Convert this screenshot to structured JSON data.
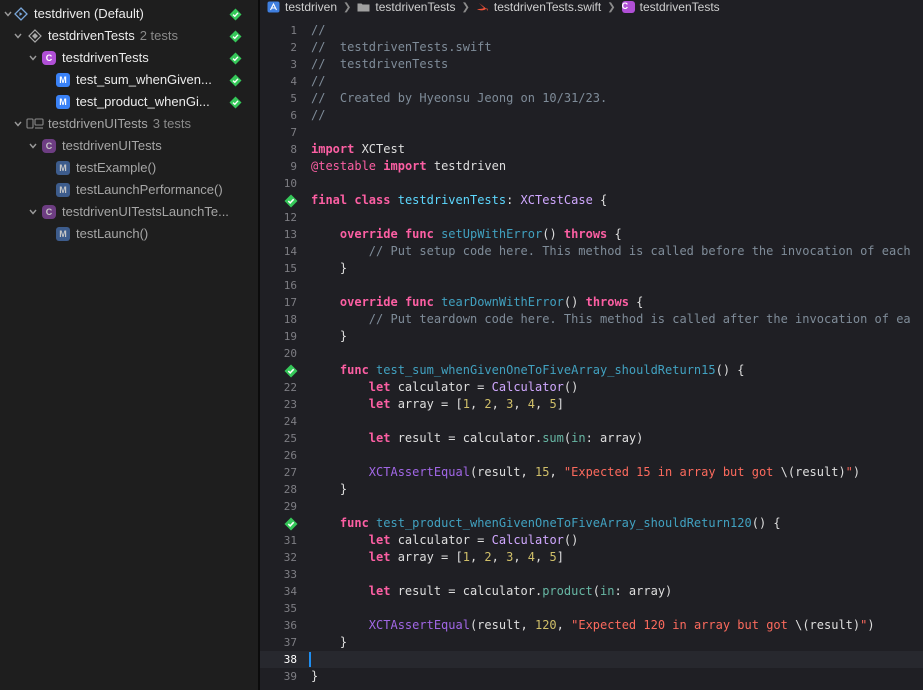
{
  "navigator": {
    "rows": [
      {
        "label": "testdriven (Default)",
        "count": "",
        "status": "passed"
      },
      {
        "label": "testdrivenTests",
        "count": "2 tests",
        "status": "passed"
      },
      {
        "label": "testdrivenTests",
        "count": "",
        "status": "passed"
      },
      {
        "label": "test_sum_whenGiven...",
        "count": "",
        "status": "passed"
      },
      {
        "label": "test_product_whenGi...",
        "count": "",
        "status": "passed"
      },
      {
        "label": "testdrivenUITests",
        "count": "3 tests",
        "status": ""
      },
      {
        "label": "testdrivenUITests",
        "count": "",
        "status": ""
      },
      {
        "label": "testExample()",
        "count": "",
        "status": ""
      },
      {
        "label": "testLaunchPerformance()",
        "count": "",
        "status": ""
      },
      {
        "label": "testdrivenUITestsLaunchTe...",
        "count": "",
        "status": ""
      },
      {
        "label": "testLaunch()",
        "count": "",
        "status": ""
      }
    ]
  },
  "jumpbar": {
    "crumbs": [
      "testdriven",
      "testdrivenTests",
      "testdrivenTests.swift",
      "testdrivenTests"
    ]
  },
  "editor": {
    "current_line": 38,
    "lines": [
      [
        {
          "c": "t-comment",
          "t": "//"
        }
      ],
      [
        {
          "c": "t-comment",
          "t": "//  testdrivenTests.swift"
        }
      ],
      [
        {
          "c": "t-comment",
          "t": "//  testdrivenTests"
        }
      ],
      [
        {
          "c": "t-comment",
          "t": "//"
        }
      ],
      [
        {
          "c": "t-comment",
          "t": "//  Created by Hyeonsu Jeong on 10/31/23."
        }
      ],
      [
        {
          "c": "t-comment",
          "t": "//"
        }
      ],
      [],
      [
        {
          "c": "t-kw",
          "t": "import"
        },
        {
          "c": "t-plain",
          "t": " XCTest"
        }
      ],
      [
        {
          "c": "t-attr",
          "t": "@testable"
        },
        {
          "c": "t-plain",
          "t": " "
        },
        {
          "c": "t-kw",
          "t": "import"
        },
        {
          "c": "t-plain",
          "t": " testdriven"
        }
      ],
      [],
      [
        {
          "c": "t-kw",
          "t": "final"
        },
        {
          "c": "t-plain",
          "t": " "
        },
        {
          "c": "t-kw",
          "t": "class"
        },
        {
          "c": "t-plain",
          "t": " "
        },
        {
          "c": "t-typename",
          "t": "testdrivenTests"
        },
        {
          "c": "t-plain",
          "t": ": "
        },
        {
          "c": "t-type",
          "t": "XCTestCase"
        },
        {
          "c": "t-plain",
          "t": " {"
        }
      ],
      [],
      [
        {
          "c": "t-plain",
          "t": "    "
        },
        {
          "c": "t-kw",
          "t": "override"
        },
        {
          "c": "t-plain",
          "t": " "
        },
        {
          "c": "t-kw",
          "t": "func"
        },
        {
          "c": "t-plain",
          "t": " "
        },
        {
          "c": "t-fn",
          "t": "setUpWithError"
        },
        {
          "c": "t-plain",
          "t": "() "
        },
        {
          "c": "t-kw",
          "t": "throws"
        },
        {
          "c": "t-plain",
          "t": " {"
        }
      ],
      [
        {
          "c": "t-plain",
          "t": "        "
        },
        {
          "c": "t-comment",
          "t": "// Put setup code here. This method is called before the invocation of each"
        }
      ],
      [
        {
          "c": "t-plain",
          "t": "    }"
        }
      ],
      [],
      [
        {
          "c": "t-plain",
          "t": "    "
        },
        {
          "c": "t-kw",
          "t": "override"
        },
        {
          "c": "t-plain",
          "t": " "
        },
        {
          "c": "t-kw",
          "t": "func"
        },
        {
          "c": "t-plain",
          "t": " "
        },
        {
          "c": "t-fn",
          "t": "tearDownWithError"
        },
        {
          "c": "t-plain",
          "t": "() "
        },
        {
          "c": "t-kw",
          "t": "throws"
        },
        {
          "c": "t-plain",
          "t": " {"
        }
      ],
      [
        {
          "c": "t-plain",
          "t": "        "
        },
        {
          "c": "t-comment",
          "t": "// Put teardown code here. This method is called after the invocation of ea"
        }
      ],
      [
        {
          "c": "t-plain",
          "t": "    }"
        }
      ],
      [],
      [
        {
          "c": "t-plain",
          "t": "    "
        },
        {
          "c": "t-kw",
          "t": "func"
        },
        {
          "c": "t-plain",
          "t": " "
        },
        {
          "c": "t-fn",
          "t": "test_sum_whenGivenOneToFiveArray_shouldReturn15"
        },
        {
          "c": "t-plain",
          "t": "() {"
        }
      ],
      [
        {
          "c": "t-plain",
          "t": "        "
        },
        {
          "c": "t-kw",
          "t": "let"
        },
        {
          "c": "t-plain",
          "t": " calculator = "
        },
        {
          "c": "t-cls",
          "t": "Calculator"
        },
        {
          "c": "t-plain",
          "t": "()"
        }
      ],
      [
        {
          "c": "t-plain",
          "t": "        "
        },
        {
          "c": "t-kw",
          "t": "let"
        },
        {
          "c": "t-plain",
          "t": " array = ["
        },
        {
          "c": "t-num",
          "t": "1"
        },
        {
          "c": "t-plain",
          "t": ", "
        },
        {
          "c": "t-num",
          "t": "2"
        },
        {
          "c": "t-plain",
          "t": ", "
        },
        {
          "c": "t-num",
          "t": "3"
        },
        {
          "c": "t-plain",
          "t": ", "
        },
        {
          "c": "t-num",
          "t": "4"
        },
        {
          "c": "t-plain",
          "t": ", "
        },
        {
          "c": "t-num",
          "t": "5"
        },
        {
          "c": "t-plain",
          "t": "]"
        }
      ],
      [],
      [
        {
          "c": "t-plain",
          "t": "        "
        },
        {
          "c": "t-kw",
          "t": "let"
        },
        {
          "c": "t-plain",
          "t": " result = calculator."
        },
        {
          "c": "t-callfn",
          "t": "sum"
        },
        {
          "c": "t-plain",
          "t": "("
        },
        {
          "c": "t-callfn",
          "t": "in"
        },
        {
          "c": "t-plain",
          "t": ": array)"
        }
      ],
      [],
      [
        {
          "c": "t-plain",
          "t": "        "
        },
        {
          "c": "t-macro",
          "t": "XCTAssertEqual"
        },
        {
          "c": "t-plain",
          "t": "(result, "
        },
        {
          "c": "t-num",
          "t": "15"
        },
        {
          "c": "t-plain",
          "t": ", "
        },
        {
          "c": "t-str",
          "t": "\"Expected 15 in array but got "
        },
        {
          "c": "t-plain",
          "t": "\\(result)"
        },
        {
          "c": "t-str",
          "t": "\""
        },
        {
          "c": "t-plain",
          "t": ")"
        }
      ],
      [
        {
          "c": "t-plain",
          "t": "    }"
        }
      ],
      [],
      [
        {
          "c": "t-plain",
          "t": "    "
        },
        {
          "c": "t-kw",
          "t": "func"
        },
        {
          "c": "t-plain",
          "t": " "
        },
        {
          "c": "t-fn",
          "t": "test_product_whenGivenOneToFiveArray_shouldReturn120"
        },
        {
          "c": "t-plain",
          "t": "() {"
        }
      ],
      [
        {
          "c": "t-plain",
          "t": "        "
        },
        {
          "c": "t-kw",
          "t": "let"
        },
        {
          "c": "t-plain",
          "t": " calculator = "
        },
        {
          "c": "t-cls",
          "t": "Calculator"
        },
        {
          "c": "t-plain",
          "t": "()"
        }
      ],
      [
        {
          "c": "t-plain",
          "t": "        "
        },
        {
          "c": "t-kw",
          "t": "let"
        },
        {
          "c": "t-plain",
          "t": " array = ["
        },
        {
          "c": "t-num",
          "t": "1"
        },
        {
          "c": "t-plain",
          "t": ", "
        },
        {
          "c": "t-num",
          "t": "2"
        },
        {
          "c": "t-plain",
          "t": ", "
        },
        {
          "c": "t-num",
          "t": "3"
        },
        {
          "c": "t-plain",
          "t": ", "
        },
        {
          "c": "t-num",
          "t": "4"
        },
        {
          "c": "t-plain",
          "t": ", "
        },
        {
          "c": "t-num",
          "t": "5"
        },
        {
          "c": "t-plain",
          "t": "]"
        }
      ],
      [],
      [
        {
          "c": "t-plain",
          "t": "        "
        },
        {
          "c": "t-kw",
          "t": "let"
        },
        {
          "c": "t-plain",
          "t": " result = calculator."
        },
        {
          "c": "t-callfn",
          "t": "product"
        },
        {
          "c": "t-plain",
          "t": "("
        },
        {
          "c": "t-callfn",
          "t": "in"
        },
        {
          "c": "t-plain",
          "t": ": array)"
        }
      ],
      [],
      [
        {
          "c": "t-plain",
          "t": "        "
        },
        {
          "c": "t-macro",
          "t": "XCTAssertEqual"
        },
        {
          "c": "t-plain",
          "t": "(result, "
        },
        {
          "c": "t-num",
          "t": "120"
        },
        {
          "c": "t-plain",
          "t": ", "
        },
        {
          "c": "t-str",
          "t": "\"Expected 120 in array but got "
        },
        {
          "c": "t-plain",
          "t": "\\(result)"
        },
        {
          "c": "t-str",
          "t": "\""
        },
        {
          "c": "t-plain",
          "t": ")"
        }
      ],
      [
        {
          "c": "t-plain",
          "t": "    }"
        }
      ],
      [],
      [
        {
          "c": "t-plain",
          "t": "}"
        }
      ]
    ],
    "passed_lines": [
      11,
      21,
      30
    ]
  },
  "colors": {
    "passed": "#35c759",
    "class_badge": "#b04fd6",
    "class_badge_dim": "#6d3d82",
    "method_badge": "#3a82f7",
    "method_badge_dim": "#3d5c8c"
  }
}
